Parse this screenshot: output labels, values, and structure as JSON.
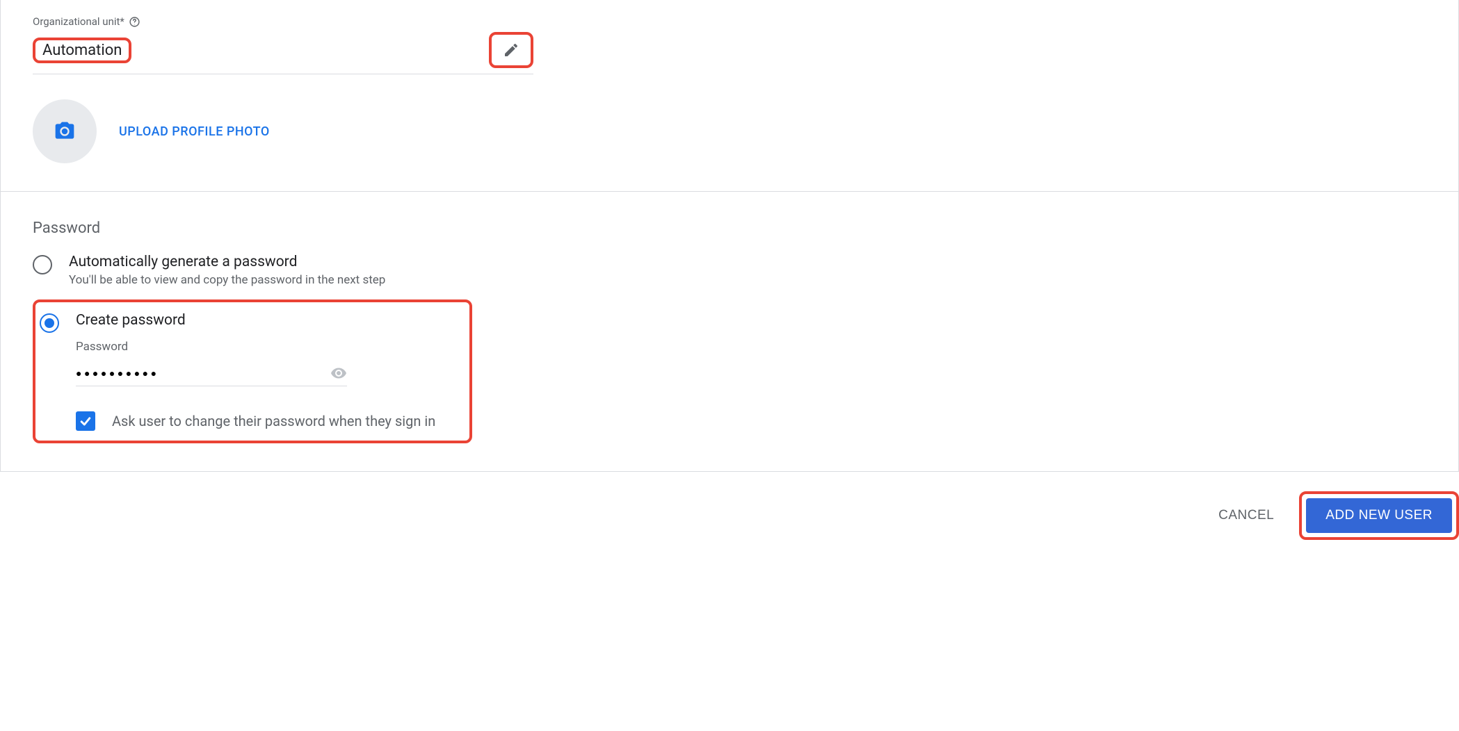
{
  "org": {
    "label": "Organizational unit*",
    "value": "Automation"
  },
  "upload": {
    "link_label": "UPLOAD PROFILE PHOTO"
  },
  "password_section": {
    "title": "Password",
    "auto": {
      "label": "Automatically generate a password",
      "sub": "You'll be able to view and copy the password in the next step"
    },
    "create": {
      "label": "Create password",
      "field_label": "Password",
      "masked_value": "●●●●●●●●●●",
      "ask_change_label": "Ask user to change their password when they sign in"
    }
  },
  "actions": {
    "cancel": "CANCEL",
    "add": "ADD NEW USER"
  }
}
